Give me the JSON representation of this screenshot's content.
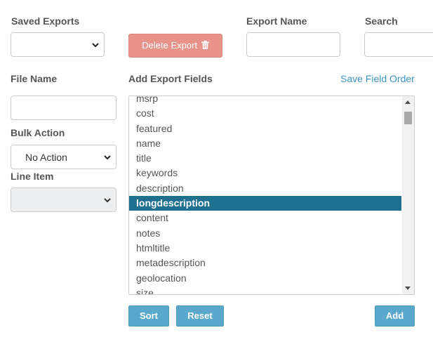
{
  "saved_exports": {
    "label": "Saved Exports",
    "value": ""
  },
  "delete_export": {
    "label": "Delete Export",
    "icon": "trash-icon"
  },
  "export_name": {
    "label": "Export Name",
    "value": ""
  },
  "search": {
    "label": "Search",
    "value": ""
  },
  "file_name": {
    "label": "File Name",
    "value": ""
  },
  "bulk_action": {
    "label": "Bulk Action",
    "value": "No Action"
  },
  "line_item": {
    "label": "Line Item",
    "value": ""
  },
  "add_export_fields": {
    "label": "Add Export Fields",
    "save_order_link": "Save Field Order",
    "fields": [
      "msrp",
      "cost",
      "featured",
      "name",
      "title",
      "keywords",
      "description",
      "longdescription",
      "content",
      "notes",
      "htmltitle",
      "metadescription",
      "geolocation",
      "size"
    ],
    "selected": "longdescription"
  },
  "buttons": {
    "sort": "Sort",
    "reset": "Reset",
    "add": "Add"
  },
  "colors": {
    "selected_row": "#1f6f8e",
    "primary_button": "#5aa8cc",
    "danger_button": "#e7938a",
    "link": "#3d94c2"
  }
}
